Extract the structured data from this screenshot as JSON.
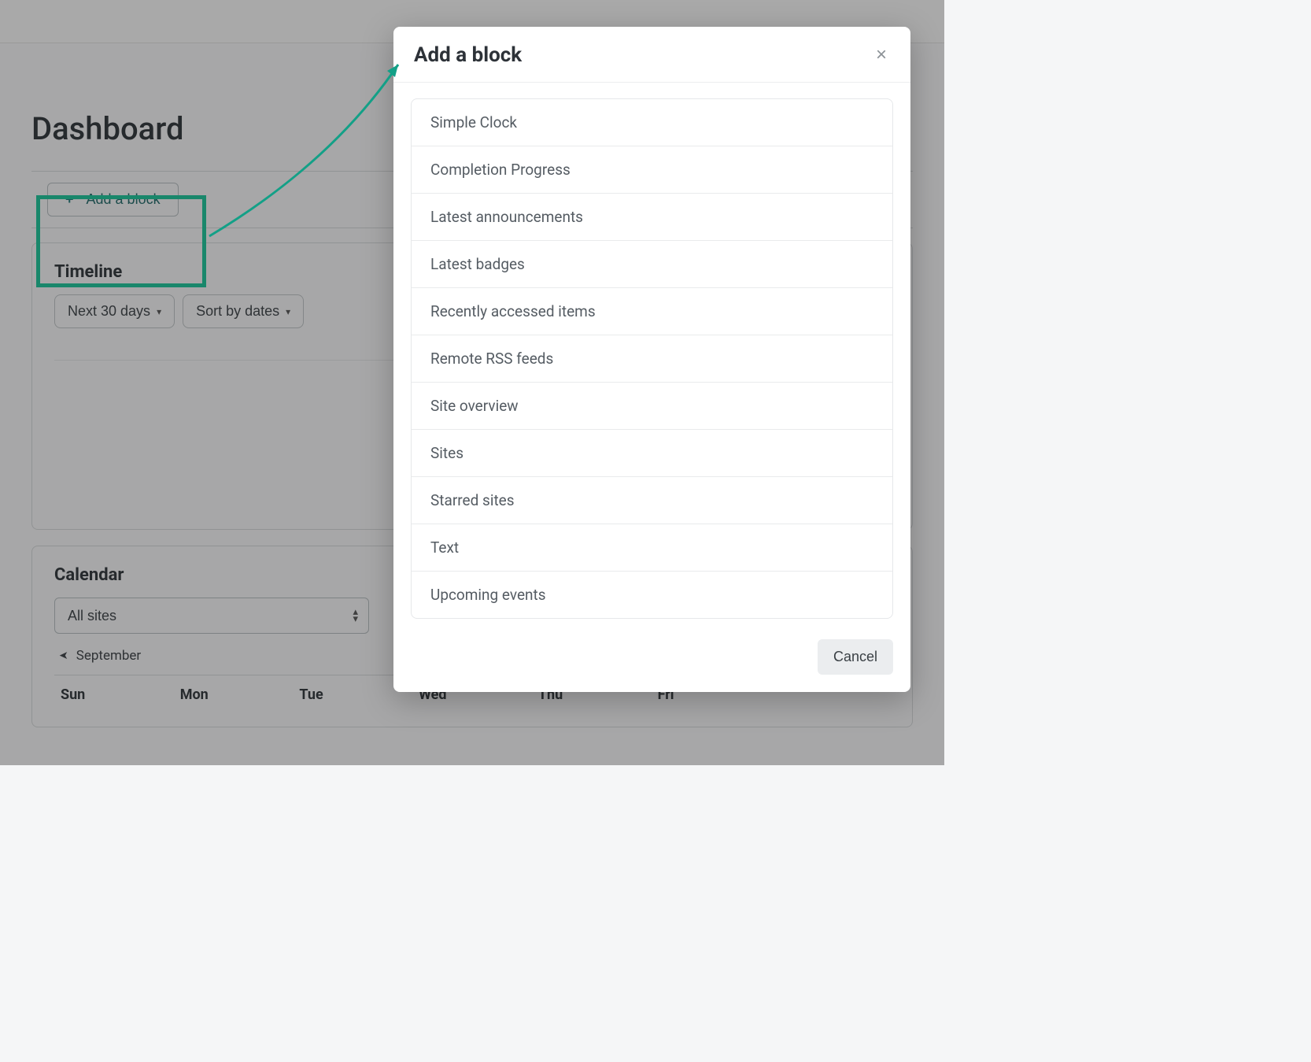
{
  "page": {
    "title": "Dashboard"
  },
  "addBlock": {
    "button_label": "Add a block"
  },
  "timeline": {
    "title": "Timeline",
    "range_label": "Next 30 days",
    "sort_label": "Sort by dates"
  },
  "calendar": {
    "title": "Calendar",
    "sites_select": "All sites",
    "month_label": "September",
    "weekdays": [
      "Sun",
      "Mon",
      "Tue",
      "Wed",
      "Thu",
      "Fri"
    ]
  },
  "modal": {
    "title": "Add a block",
    "cancel_label": "Cancel",
    "items": [
      "Simple Clock",
      "Completion Progress",
      "Latest announcements",
      "Latest badges",
      "Recently accessed items",
      "Remote RSS feeds",
      "Site overview",
      "Sites",
      "Starred sites",
      "Text",
      "Upcoming events"
    ]
  },
  "colors": {
    "highlight": "#17c99b",
    "arrow": "#13a087"
  }
}
